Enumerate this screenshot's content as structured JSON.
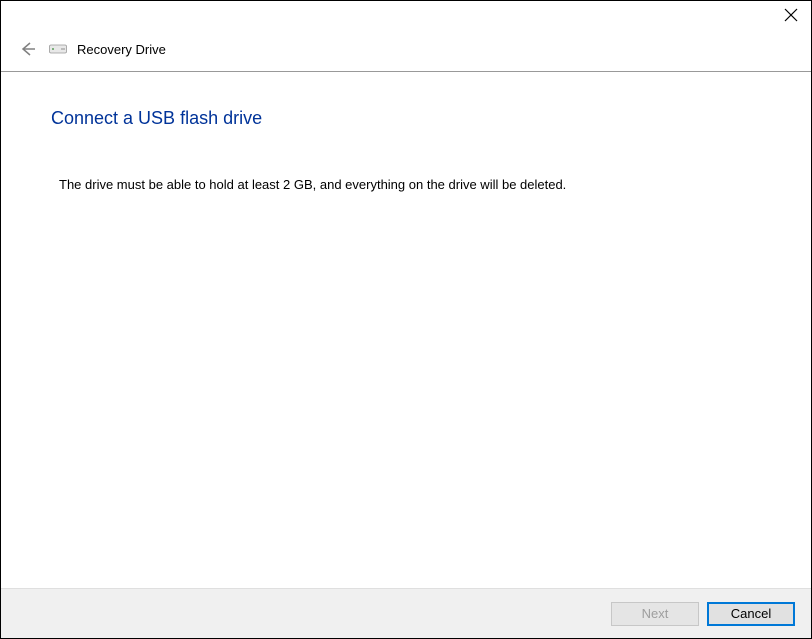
{
  "header": {
    "title": "Recovery Drive"
  },
  "main": {
    "heading": "Connect a USB flash drive",
    "body": "The drive must be able to hold at least 2 GB, and everything on the drive will be deleted."
  },
  "footer": {
    "next_label": "Next",
    "cancel_label": "Cancel"
  }
}
